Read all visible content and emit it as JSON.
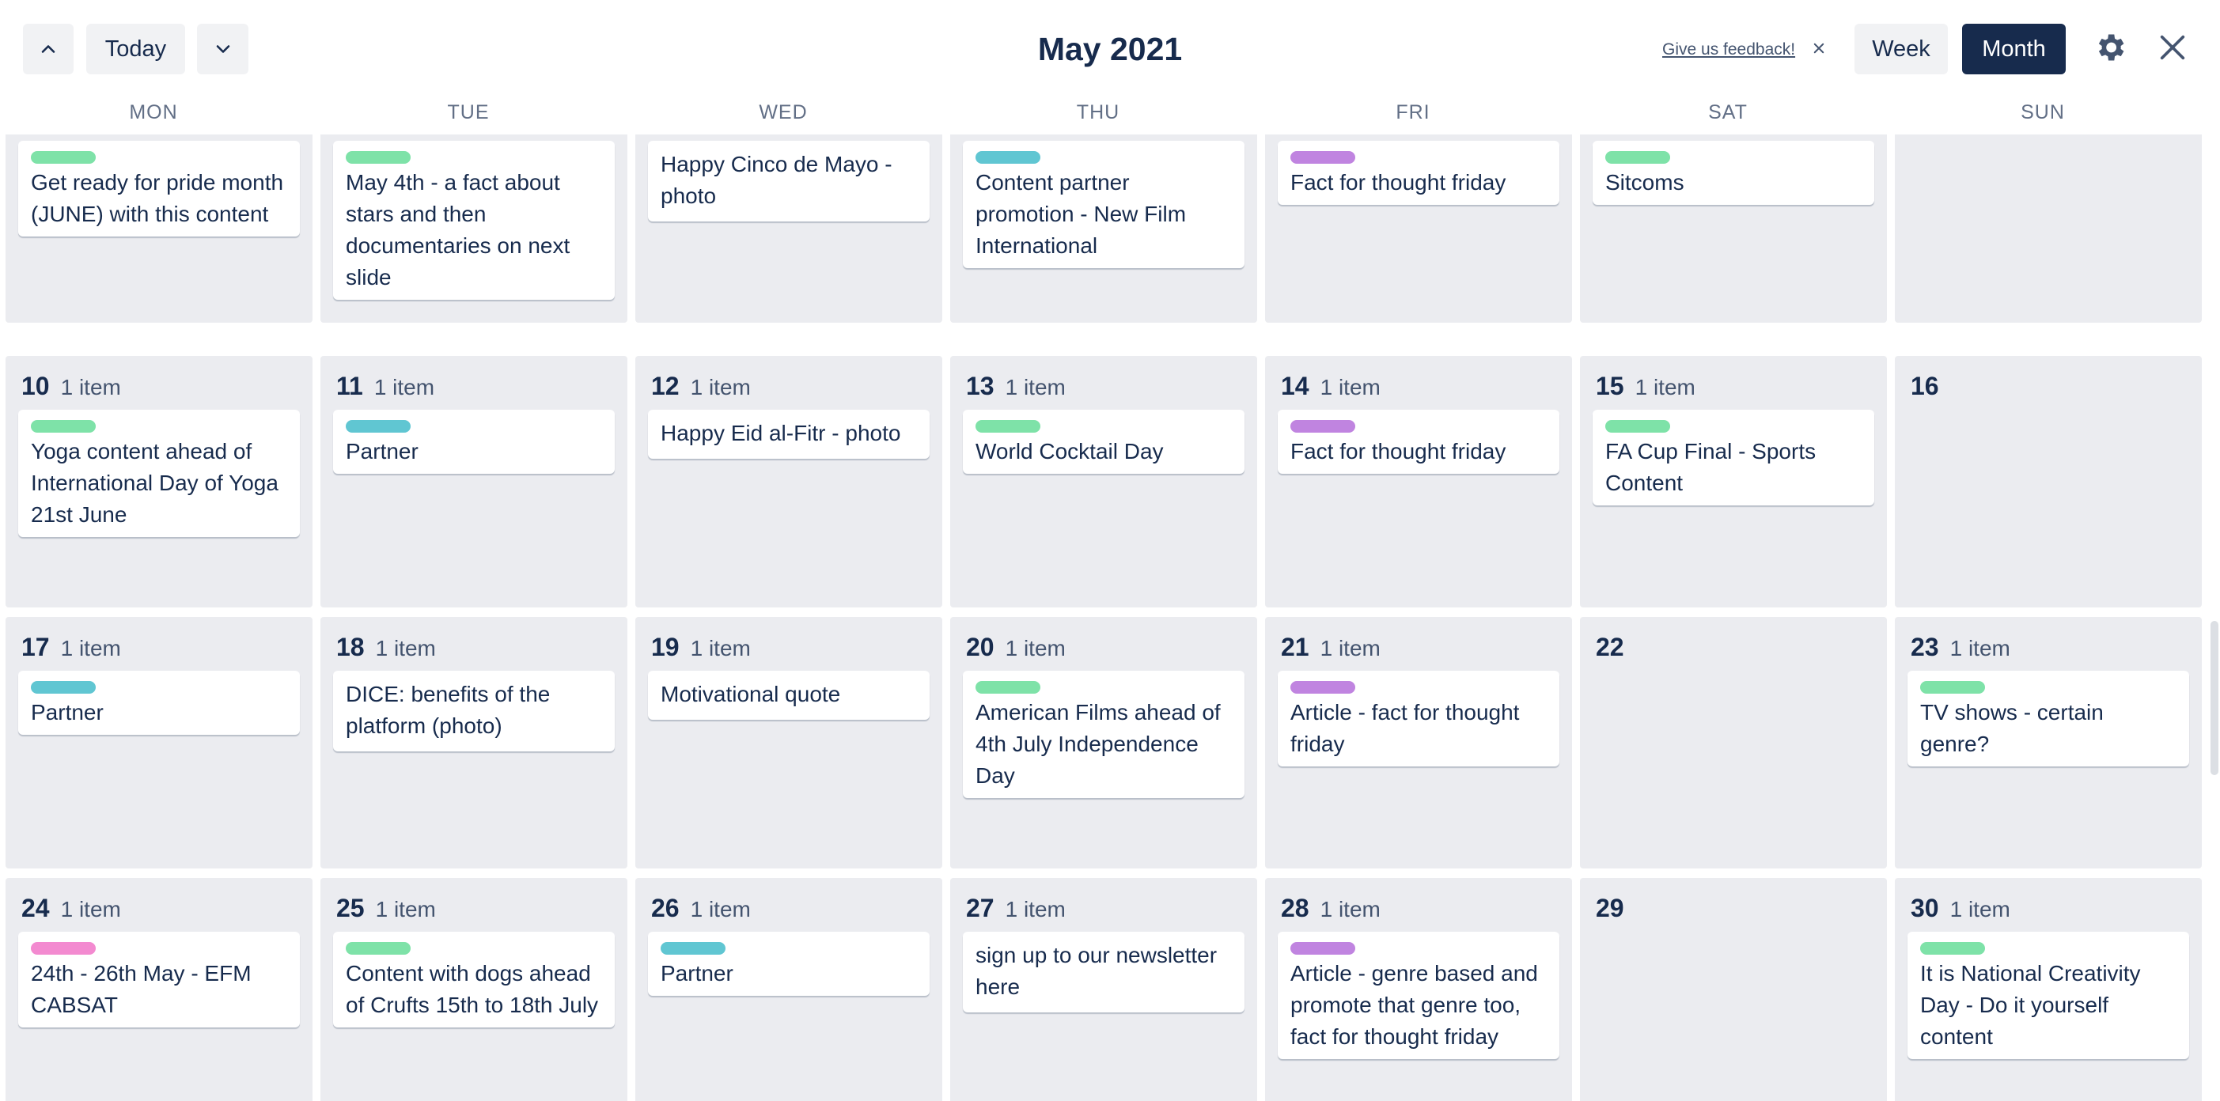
{
  "header": {
    "today_label": "Today",
    "title": "May 2021",
    "feedback_label": "Give us feedback!",
    "week_label": "Week",
    "month_label": "Month"
  },
  "weekdays": [
    "MON",
    "TUE",
    "WED",
    "THU",
    "FRI",
    "SAT",
    "SUN"
  ],
  "colors": {
    "green": "#7ee2a8",
    "blue": "#60c6d2",
    "purple": "#c084e0",
    "pink": "#f38ad0",
    "navy": "#172b4d"
  },
  "weeks": [
    [
      {
        "day": "",
        "count": "",
        "card": {
          "label": "green",
          "text": "Get ready for pride month (JUNE) with this content"
        }
      },
      {
        "day": "",
        "count": "",
        "card": {
          "label": "green",
          "text": "May 4th - a fact about stars and then documentaries on next slide"
        }
      },
      {
        "day": "",
        "count": "",
        "card": {
          "label": "",
          "text": "Happy Cinco de Mayo - photo"
        }
      },
      {
        "day": "",
        "count": "",
        "card": {
          "label": "blue",
          "text": "Content partner promotion - New Film International"
        }
      },
      {
        "day": "",
        "count": "",
        "card": {
          "label": "purple",
          "text": "Fact for thought friday"
        }
      },
      {
        "day": "",
        "count": "",
        "card": {
          "label": "green",
          "text": "Sitcoms"
        }
      },
      {
        "day": "",
        "count": "",
        "card": null
      }
    ],
    [
      {
        "day": "10",
        "count": "1 item",
        "card": {
          "label": "green",
          "text": "Yoga content ahead of International Day of Yoga 21st June"
        }
      },
      {
        "day": "11",
        "count": "1 item",
        "card": {
          "label": "blue",
          "text": "Partner"
        }
      },
      {
        "day": "12",
        "count": "1 item",
        "card": {
          "label": "",
          "text": "Happy Eid al-Fitr - photo"
        }
      },
      {
        "day": "13",
        "count": "1 item",
        "card": {
          "label": "green",
          "text": "World Cocktail Day"
        }
      },
      {
        "day": "14",
        "count": "1 item",
        "card": {
          "label": "purple",
          "text": "Fact for thought friday"
        }
      },
      {
        "day": "15",
        "count": "1 item",
        "card": {
          "label": "green",
          "text": "FA Cup Final - Sports Content"
        }
      },
      {
        "day": "16",
        "count": "",
        "card": null
      }
    ],
    [
      {
        "day": "17",
        "count": "1 item",
        "card": {
          "label": "blue",
          "text": "Partner"
        }
      },
      {
        "day": "18",
        "count": "1 item",
        "card": {
          "label": "",
          "text": "DICE: benefits of the platform (photo)"
        }
      },
      {
        "day": "19",
        "count": "1 item",
        "card": {
          "label": "",
          "text": "Motivational quote"
        }
      },
      {
        "day": "20",
        "count": "1 item",
        "card": {
          "label": "green",
          "text": "American Films ahead of 4th July Independence Day"
        }
      },
      {
        "day": "21",
        "count": "1 item",
        "card": {
          "label": "purple",
          "text": "Article - fact for thought friday"
        }
      },
      {
        "day": "22",
        "count": "",
        "card": null
      },
      {
        "day": "23",
        "count": "1 item",
        "card": {
          "label": "green",
          "text": "TV shows - certain genre?"
        }
      }
    ],
    [
      {
        "day": "24",
        "count": "1 item",
        "card": {
          "label": "pink",
          "text": "24th - 26th May - EFM CABSAT"
        }
      },
      {
        "day": "25",
        "count": "1 item",
        "card": {
          "label": "green",
          "text": "Content with dogs ahead of Crufts 15th to 18th July"
        }
      },
      {
        "day": "26",
        "count": "1 item",
        "card": {
          "label": "blue",
          "text": "Partner"
        }
      },
      {
        "day": "27",
        "count": "1 item",
        "card": {
          "label": "",
          "text": "sign up to our newsletter here"
        }
      },
      {
        "day": "28",
        "count": "1 item",
        "card": {
          "label": "purple",
          "text": "Article - genre based and promote that genre too, fact for thought friday"
        }
      },
      {
        "day": "29",
        "count": "",
        "card": null
      },
      {
        "day": "30",
        "count": "1 item",
        "card": {
          "label": "green",
          "text": "It is National Creativity Day - Do it yourself content"
        }
      }
    ]
  ]
}
